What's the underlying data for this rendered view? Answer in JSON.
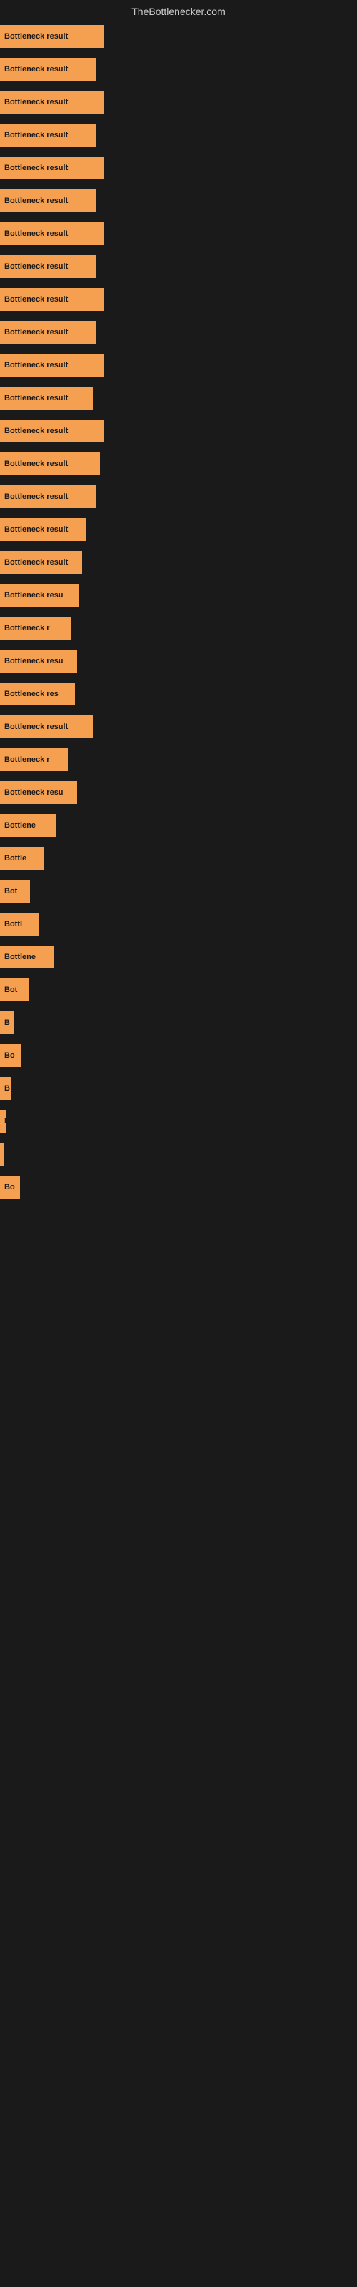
{
  "header": {
    "title": "TheBottlenecker.com"
  },
  "bars": [
    {
      "label": "Bottleneck result",
      "width": 145
    },
    {
      "label": "Bottleneck result",
      "width": 135
    },
    {
      "label": "Bottleneck result",
      "width": 145
    },
    {
      "label": "Bottleneck result",
      "width": 135
    },
    {
      "label": "Bottleneck result",
      "width": 145
    },
    {
      "label": "Bottleneck result",
      "width": 135
    },
    {
      "label": "Bottleneck result",
      "width": 145
    },
    {
      "label": "Bottleneck result",
      "width": 135
    },
    {
      "label": "Bottleneck result",
      "width": 145
    },
    {
      "label": "Bottleneck result",
      "width": 135
    },
    {
      "label": "Bottleneck result",
      "width": 145
    },
    {
      "label": "Bottleneck result",
      "width": 130
    },
    {
      "label": "Bottleneck result",
      "width": 145
    },
    {
      "label": "Bottleneck result",
      "width": 140
    },
    {
      "label": "Bottleneck result",
      "width": 135
    },
    {
      "label": "Bottleneck result",
      "width": 120
    },
    {
      "label": "Bottleneck result",
      "width": 115
    },
    {
      "label": "Bottleneck resu",
      "width": 110
    },
    {
      "label": "Bottleneck r",
      "width": 100
    },
    {
      "label": "Bottleneck resu",
      "width": 108
    },
    {
      "label": "Bottleneck res",
      "width": 105
    },
    {
      "label": "Bottleneck result",
      "width": 130
    },
    {
      "label": "Bottleneck r",
      "width": 95
    },
    {
      "label": "Bottleneck resu",
      "width": 108
    },
    {
      "label": "Bottlene",
      "width": 78
    },
    {
      "label": "Bottle",
      "width": 62
    },
    {
      "label": "Bot",
      "width": 42
    },
    {
      "label": "Bottl",
      "width": 55
    },
    {
      "label": "Bottlene",
      "width": 75
    },
    {
      "label": "Bot",
      "width": 40
    },
    {
      "label": "B",
      "width": 20
    },
    {
      "label": "Bo",
      "width": 30
    },
    {
      "label": "B",
      "width": 16
    },
    {
      "label": "l",
      "width": 8
    },
    {
      "label": "",
      "width": 4
    },
    {
      "label": "Bo",
      "width": 28
    }
  ]
}
